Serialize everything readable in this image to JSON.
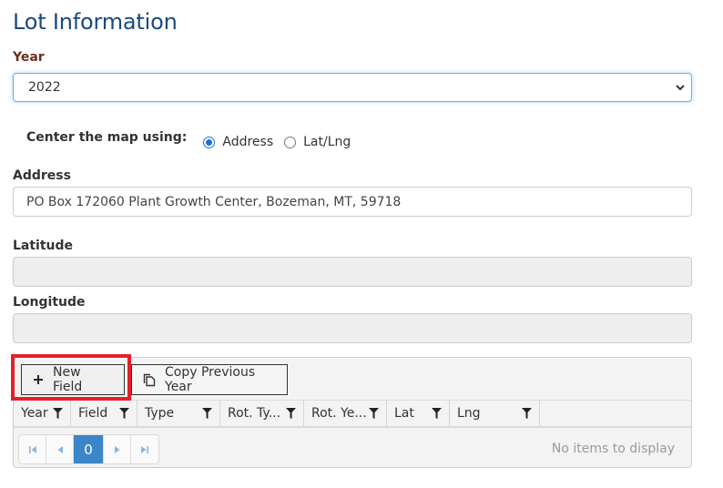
{
  "page": {
    "title": "Lot Information"
  },
  "year": {
    "label": "Year",
    "selected": "2022",
    "icon": "chevron-down-icon"
  },
  "center_map": {
    "label": "Center the map using:",
    "options": [
      {
        "label": "Address",
        "checked": true
      },
      {
        "label": "Lat/Lng",
        "checked": false
      }
    ]
  },
  "address": {
    "label": "Address",
    "value": "PO Box 172060 Plant Growth Center, Bozeman, MT, 59718"
  },
  "latitude": {
    "label": "Latitude",
    "value": ""
  },
  "longitude": {
    "label": "Longitude",
    "value": ""
  },
  "grid": {
    "toolbar": {
      "new_field_label": "New Field",
      "new_field_icon": "plus-icon",
      "copy_previous_label": "Copy Previous Year",
      "copy_previous_icon": "copy-icon"
    },
    "columns": [
      {
        "label": "Year"
      },
      {
        "label": "Field"
      },
      {
        "label": "Type"
      },
      {
        "label": "Rot. Ty..."
      },
      {
        "label": "Rot. Ye..."
      },
      {
        "label": "Lat"
      },
      {
        "label": "Lng"
      }
    ],
    "rows": [],
    "pager": {
      "current_page": "0",
      "status": "No items to display"
    }
  },
  "colors": {
    "title": "#1a4a80",
    "highlight": "#e3202a",
    "pager_active": "#3b86c8"
  }
}
